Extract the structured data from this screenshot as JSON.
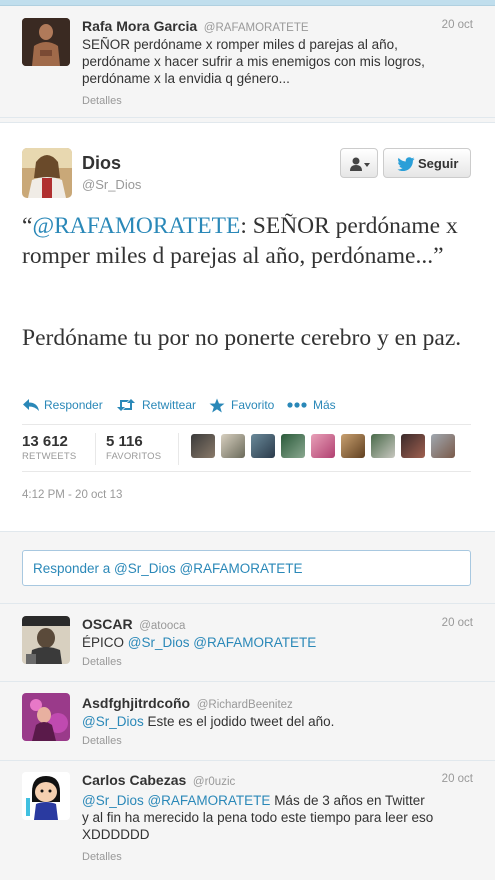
{
  "top_tweet": {
    "fullname": "Rafa Mora Garcia",
    "username": "@RAFAMORATETE",
    "date": "20 oct",
    "text_lines": [
      "SEÑOR perdóname x romper miles d parejas al año,",
      "perdóname x hacer sufrir a mis enemigos con mis logros,",
      "perdóname x la envidia q género..."
    ],
    "details": "Detalles"
  },
  "main_tweet": {
    "fullname": "Dios",
    "username": "@Sr_Dios",
    "follow_label": "Seguir",
    "quote_open": "“",
    "quote_mention": "@RAFAMORATETE",
    "quote_rest": ": SEÑOR perdóname x romper miles d parejas al año, perdóname...”",
    "reply_text": "Perdóname tu por no ponerte cerebro y en paz.",
    "actions": {
      "reply": "Responder",
      "retweet": "Retwittear",
      "favorite": "Favorito",
      "more": "Más"
    },
    "stats": {
      "retweets": "13 612",
      "retweets_label": "RETWEETS",
      "favorites": "5 116",
      "favorites_label": "FAVORITOS"
    },
    "timestamp": "4:12 PM - 20 oct 13"
  },
  "reply_box": {
    "placeholder": "Responder a @Sr_Dios @RAFAMORATETE"
  },
  "replies": [
    {
      "fullname": "OSCAR",
      "username": "@atooca",
      "date": "20 oct",
      "mention": "",
      "text": "ÉPICO @Sr_Dios @RAFAMORATETE",
      "details": "Detalles"
    },
    {
      "fullname": "Asdfghjitrdcoño",
      "username": "@RichardBeenitez",
      "date": "",
      "mention": "@Sr_Dios",
      "text": " Este es el jodido tweet del año.",
      "details": "Detalles"
    },
    {
      "fullname": "Carlos Cabezas",
      "username": "@r0uzic",
      "date": "20 oct",
      "line1": "@Sr_Dios @RAFAMORATETE Más de 3 años en Twitter",
      "line2": "y al fin ha merecido la pena todo este tiempo para leer eso",
      "line3": "XDDDDDD",
      "details": "Detalles"
    }
  ],
  "colors": {
    "link": "#2a88b8",
    "muted": "#999999",
    "text": "#333333",
    "background": "#f5f5f5"
  },
  "icons": [
    "reply-arrow-icon",
    "retweet-icon",
    "star-icon",
    "more-dots-icon",
    "twitter-bird-icon",
    "user-icon",
    "caret-down-icon"
  ]
}
